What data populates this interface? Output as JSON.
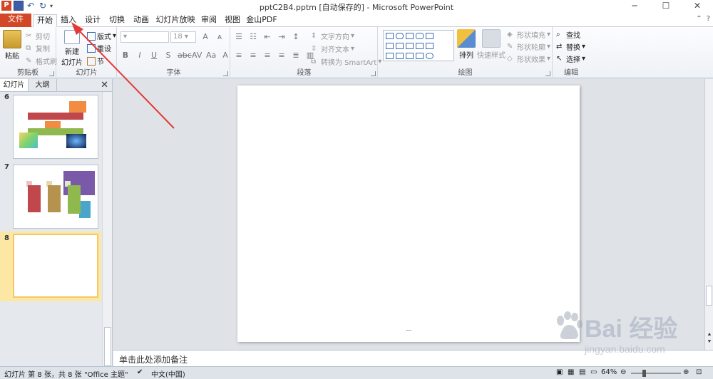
{
  "titlebar": {
    "title": "pptC2B4.pptm [自动保存的] - Microsoft PowerPoint",
    "app_logo": "P",
    "minimize": "─",
    "maximize": "☐",
    "close": "✕"
  },
  "tabs": [
    {
      "label": "文件"
    },
    {
      "label": "开始"
    },
    {
      "label": "插入"
    },
    {
      "label": "设计"
    },
    {
      "label": "切换"
    },
    {
      "label": "动画"
    },
    {
      "label": "幻灯片放映"
    },
    {
      "label": "审阅"
    },
    {
      "label": "视图"
    },
    {
      "label": "金山PDF"
    }
  ],
  "ribbon": {
    "clipboard": {
      "label": "剪贴板",
      "paste": "粘贴",
      "cut": "剪切",
      "copy": "复制",
      "format_painter": "格式刷"
    },
    "slides": {
      "label": "幻灯片",
      "new_slide_line1": "新建",
      "new_slide_line2": "幻灯片",
      "layout": "版式",
      "reset": "重设",
      "section": "节"
    },
    "font": {
      "label": "字体",
      "size": "18"
    },
    "paragraph": {
      "label": "段落",
      "text_direction": "文字方向",
      "align_text": "对齐文本",
      "convert_smartart": "转换为 SmartArt"
    },
    "drawing": {
      "label": "绘图",
      "arrange": "排列",
      "quick_styles": "快速样式",
      "shape_fill": "形状填充",
      "shape_outline": "形状轮廓",
      "shape_effects": "形状效果"
    },
    "editing": {
      "label": "编辑",
      "find": "查找",
      "replace": "替换",
      "select": "选择"
    }
  },
  "panel": {
    "tab_slides": "幻灯片",
    "tab_outline": "大纲",
    "close": "✕",
    "thumbnails": [
      {
        "number": "6"
      },
      {
        "number": "7"
      },
      {
        "number": "8"
      }
    ]
  },
  "notes": {
    "placeholder": "单击此处添加备注"
  },
  "statusbar": {
    "slide_info": "幻灯片 第 8 张，共 8 张",
    "theme": "\"Office 主题\"",
    "language": "中文(中国)",
    "zoom": "64%"
  },
  "watermark": {
    "brand": "Bai 经验",
    "url": "jingyan.baidu.com"
  },
  "colors": {
    "file_tab": "#d24726",
    "annotation_arrow": "#e53935",
    "selection_highlight": "#fde7a4"
  }
}
